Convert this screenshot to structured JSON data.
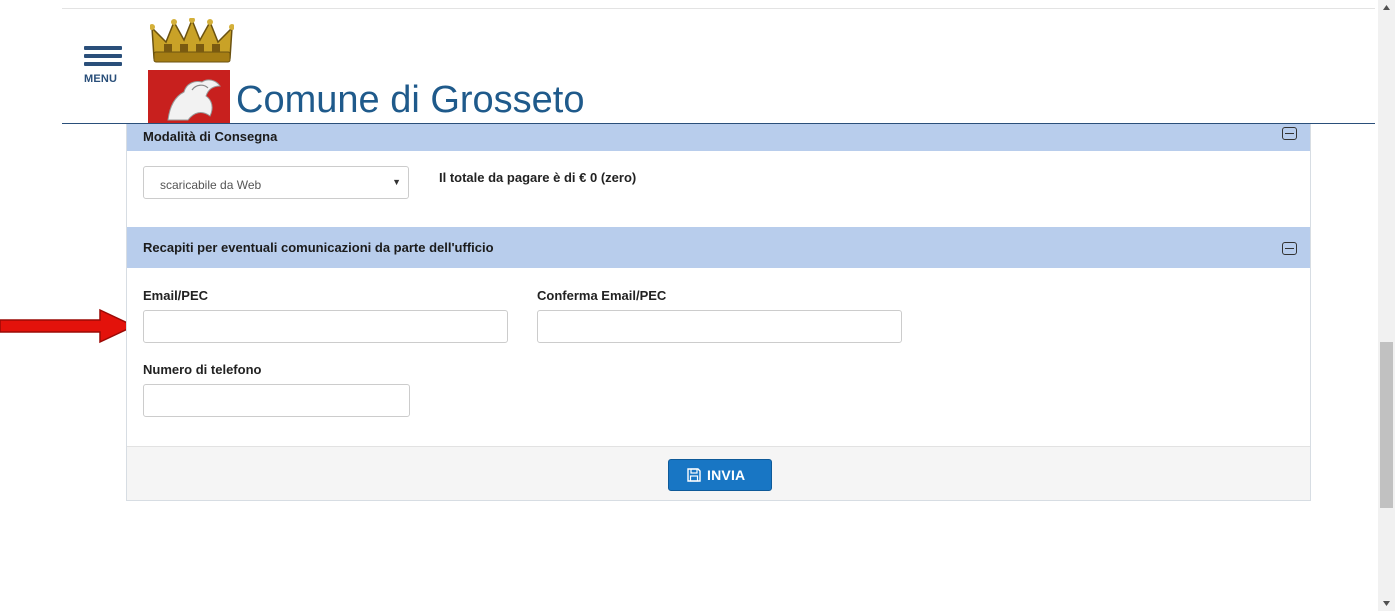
{
  "header": {
    "menu_label": "MENU",
    "site_title": "Comune di Grosseto"
  },
  "delivery_section": {
    "title": "Modalità di Consegna",
    "select_value": "scaricabile da Web",
    "total_text": "Il totale da pagare è di € 0 (zero)"
  },
  "contacts_section": {
    "title": "Recapiti per eventuali comunicazioni da parte dell'ufficio",
    "email_label": "Email/PEC",
    "email_value": "",
    "confirm_email_label": "Conferma Email/PEC",
    "confirm_email_value": "",
    "phone_label": "Numero di telefono",
    "phone_value": ""
  },
  "actions": {
    "submit_label": "INVIA"
  },
  "colors": {
    "section_header_bg": "#b8cdec",
    "title_blue": "#1f5a8b",
    "submit_bg": "#1876c4",
    "arrow_red": "#e3120b"
  },
  "icons": [
    "menu-icon",
    "crown-logo",
    "coat-of-arms-logo",
    "collapse-icon",
    "save-icon",
    "red-arrow-annotation"
  ]
}
